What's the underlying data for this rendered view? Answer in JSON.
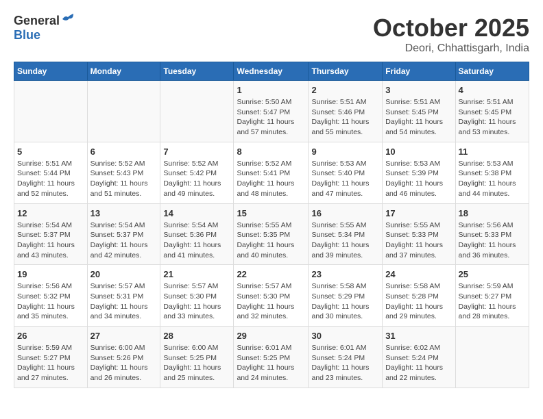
{
  "logo": {
    "general": "General",
    "blue": "Blue"
  },
  "title": "October 2025",
  "subtitle": "Deori, Chhattisgarh, India",
  "days_of_week": [
    "Sunday",
    "Monday",
    "Tuesday",
    "Wednesday",
    "Thursday",
    "Friday",
    "Saturday"
  ],
  "weeks": [
    [
      {
        "day": "",
        "info": ""
      },
      {
        "day": "",
        "info": ""
      },
      {
        "day": "",
        "info": ""
      },
      {
        "day": "1",
        "info": "Sunrise: 5:50 AM\nSunset: 5:47 PM\nDaylight: 11 hours and 57 minutes."
      },
      {
        "day": "2",
        "info": "Sunrise: 5:51 AM\nSunset: 5:46 PM\nDaylight: 11 hours and 55 minutes."
      },
      {
        "day": "3",
        "info": "Sunrise: 5:51 AM\nSunset: 5:45 PM\nDaylight: 11 hours and 54 minutes."
      },
      {
        "day": "4",
        "info": "Sunrise: 5:51 AM\nSunset: 5:45 PM\nDaylight: 11 hours and 53 minutes."
      }
    ],
    [
      {
        "day": "5",
        "info": "Sunrise: 5:51 AM\nSunset: 5:44 PM\nDaylight: 11 hours and 52 minutes."
      },
      {
        "day": "6",
        "info": "Sunrise: 5:52 AM\nSunset: 5:43 PM\nDaylight: 11 hours and 51 minutes."
      },
      {
        "day": "7",
        "info": "Sunrise: 5:52 AM\nSunset: 5:42 PM\nDaylight: 11 hours and 49 minutes."
      },
      {
        "day": "8",
        "info": "Sunrise: 5:52 AM\nSunset: 5:41 PM\nDaylight: 11 hours and 48 minutes."
      },
      {
        "day": "9",
        "info": "Sunrise: 5:53 AM\nSunset: 5:40 PM\nDaylight: 11 hours and 47 minutes."
      },
      {
        "day": "10",
        "info": "Sunrise: 5:53 AM\nSunset: 5:39 PM\nDaylight: 11 hours and 46 minutes."
      },
      {
        "day": "11",
        "info": "Sunrise: 5:53 AM\nSunset: 5:38 PM\nDaylight: 11 hours and 44 minutes."
      }
    ],
    [
      {
        "day": "12",
        "info": "Sunrise: 5:54 AM\nSunset: 5:37 PM\nDaylight: 11 hours and 43 minutes."
      },
      {
        "day": "13",
        "info": "Sunrise: 5:54 AM\nSunset: 5:37 PM\nDaylight: 11 hours and 42 minutes."
      },
      {
        "day": "14",
        "info": "Sunrise: 5:54 AM\nSunset: 5:36 PM\nDaylight: 11 hours and 41 minutes."
      },
      {
        "day": "15",
        "info": "Sunrise: 5:55 AM\nSunset: 5:35 PM\nDaylight: 11 hours and 40 minutes."
      },
      {
        "day": "16",
        "info": "Sunrise: 5:55 AM\nSunset: 5:34 PM\nDaylight: 11 hours and 39 minutes."
      },
      {
        "day": "17",
        "info": "Sunrise: 5:55 AM\nSunset: 5:33 PM\nDaylight: 11 hours and 37 minutes."
      },
      {
        "day": "18",
        "info": "Sunrise: 5:56 AM\nSunset: 5:33 PM\nDaylight: 11 hours and 36 minutes."
      }
    ],
    [
      {
        "day": "19",
        "info": "Sunrise: 5:56 AM\nSunset: 5:32 PM\nDaylight: 11 hours and 35 minutes."
      },
      {
        "day": "20",
        "info": "Sunrise: 5:57 AM\nSunset: 5:31 PM\nDaylight: 11 hours and 34 minutes."
      },
      {
        "day": "21",
        "info": "Sunrise: 5:57 AM\nSunset: 5:30 PM\nDaylight: 11 hours and 33 minutes."
      },
      {
        "day": "22",
        "info": "Sunrise: 5:57 AM\nSunset: 5:30 PM\nDaylight: 11 hours and 32 minutes."
      },
      {
        "day": "23",
        "info": "Sunrise: 5:58 AM\nSunset: 5:29 PM\nDaylight: 11 hours and 30 minutes."
      },
      {
        "day": "24",
        "info": "Sunrise: 5:58 AM\nSunset: 5:28 PM\nDaylight: 11 hours and 29 minutes."
      },
      {
        "day": "25",
        "info": "Sunrise: 5:59 AM\nSunset: 5:27 PM\nDaylight: 11 hours and 28 minutes."
      }
    ],
    [
      {
        "day": "26",
        "info": "Sunrise: 5:59 AM\nSunset: 5:27 PM\nDaylight: 11 hours and 27 minutes."
      },
      {
        "day": "27",
        "info": "Sunrise: 6:00 AM\nSunset: 5:26 PM\nDaylight: 11 hours and 26 minutes."
      },
      {
        "day": "28",
        "info": "Sunrise: 6:00 AM\nSunset: 5:25 PM\nDaylight: 11 hours and 25 minutes."
      },
      {
        "day": "29",
        "info": "Sunrise: 6:01 AM\nSunset: 5:25 PM\nDaylight: 11 hours and 24 minutes."
      },
      {
        "day": "30",
        "info": "Sunrise: 6:01 AM\nSunset: 5:24 PM\nDaylight: 11 hours and 23 minutes."
      },
      {
        "day": "31",
        "info": "Sunrise: 6:02 AM\nSunset: 5:24 PM\nDaylight: 11 hours and 22 minutes."
      },
      {
        "day": "",
        "info": ""
      }
    ]
  ]
}
